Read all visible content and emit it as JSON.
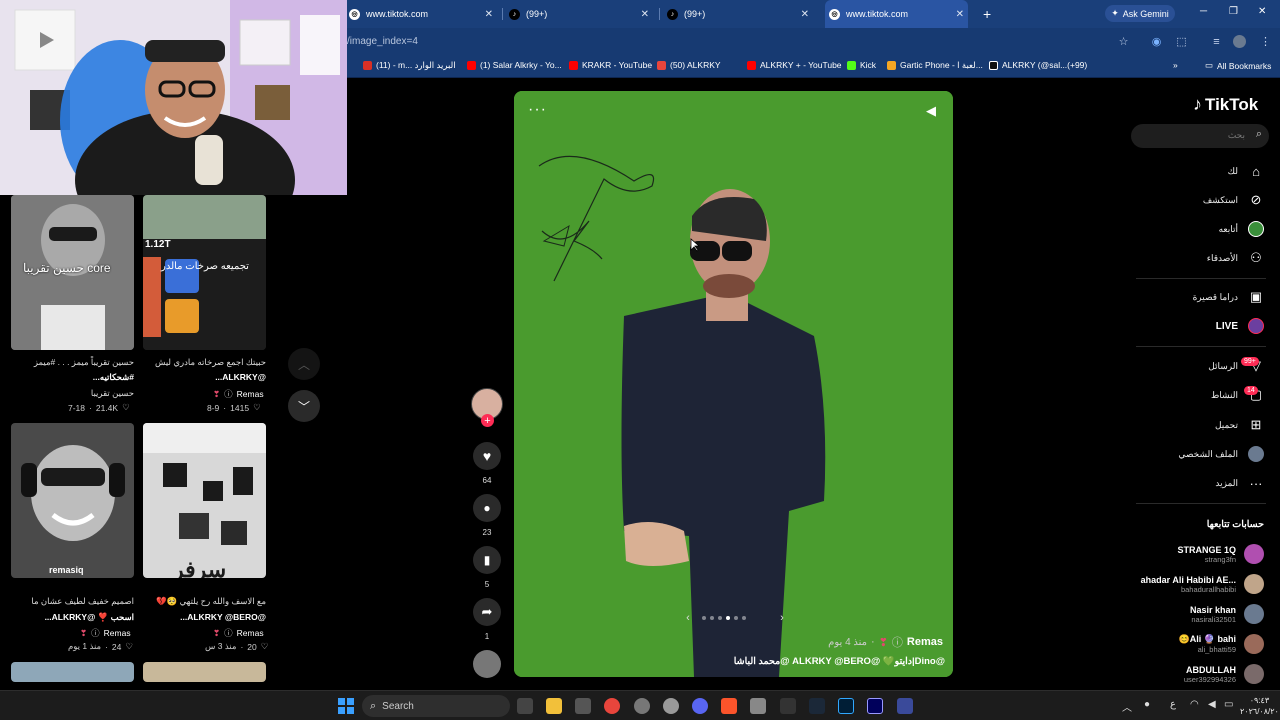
{
  "browser": {
    "tabs": [
      {
        "label": "www.tiktok.com"
      },
      {
        "label": "(99+)"
      },
      {
        "label": "(99+)"
      },
      {
        "label": "www.tiktok.com"
      }
    ],
    "gemini_label": "Ask Gemini",
    "url": "/image_index=4",
    "bookmarks": [
      {
        "label": "(11) - m... البريد الوارد",
        "color": "#d93025"
      },
      {
        "label": "(1) Salar Alkrky - Yo...",
        "color": "#ff0000"
      },
      {
        "label": "KRAKR - YouTube",
        "color": "#ff0000"
      },
      {
        "label": "(50) ALKRKY",
        "color": "#e8453c"
      },
      {
        "label": "ALKRKY + - YouTube",
        "color": "#ff0000"
      },
      {
        "label": "Kick",
        "color": "#53fc18"
      },
      {
        "label": "Gartic Phone - لعبة ا...",
        "color": "#f5a623"
      },
      {
        "label": "ALKRKY (@sal...(+99)",
        "color": "#111111"
      }
    ],
    "all_bookmarks": "All Bookmarks"
  },
  "grid": {
    "cards": [
      {
        "overlay": "حسين تقريبا core",
        "caption1": "حسين تقريباً ميمز . . . #ميمز",
        "caption2": "#شحكاتيه...",
        "author": "حسين تقريبا",
        "meta_date": "7-18",
        "meta_likes": "21.4K"
      },
      {
        "overlay": "1.12T",
        "overlay2": "تجميعه صرخات مالدر",
        "caption1": "حبيتك اجمع صرخاته مادري ليش",
        "caption2": "@ALKRKY...",
        "author": "Remas",
        "meta_date": "8-9",
        "meta_likes": "1415"
      },
      {
        "overlay": "remasiq",
        "caption1": "اصميم خفيف لطيف عشان ما",
        "caption2": "اسحب ❣️ @ALKRKY...",
        "author": "Remas",
        "meta_date": "منذ 1 يوم",
        "meta_likes": "24"
      },
      {
        "overlay": "سرفر",
        "caption1": "مع الاسف والله رح يلتهي 🥺💔",
        "caption2": "@ALKRKY @BERO...",
        "author": "Remas",
        "meta_date": "منذ 3 س",
        "meta_likes": "20"
      }
    ]
  },
  "post": {
    "author": "Remas",
    "time": "منذ 4 يوم",
    "caption": "@Dino|دايتو💚 @ALKRKY @BERO @محمد الباشا",
    "likes": "64",
    "comments": "23",
    "saves": "5",
    "shares": "1",
    "slides_total": 6,
    "slide_index": 3
  },
  "tiktok": {
    "logo": "TikTok",
    "search_placeholder": "بحث",
    "nav": [
      {
        "label": "لك",
        "icon": "home-icon"
      },
      {
        "label": "استكشف",
        "icon": "compass-icon"
      },
      {
        "label": "أتابعه",
        "icon": "following-avatar-icon"
      },
      {
        "label": "الأصدقاء",
        "icon": "friends-icon"
      },
      {
        "label": "دراما قصيرة",
        "icon": "drama-icon"
      },
      {
        "label": "LIVE",
        "icon": "live-icon"
      },
      {
        "label": "الرسائل",
        "icon": "messages-icon",
        "badge": "99+"
      },
      {
        "label": "النشاط",
        "icon": "activity-icon",
        "badge": "14"
      },
      {
        "label": "تحميل",
        "icon": "upload-icon"
      },
      {
        "label": "الملف الشخصي",
        "icon": "profile-icon"
      },
      {
        "label": "المزيد",
        "icon": "more-icon"
      }
    ],
    "following_title": "حسابات تتابعها",
    "following": [
      {
        "name": "STRANGE 1Q",
        "handle": "strang3fn",
        "color": "#b04fb0"
      },
      {
        "name": "ahadar Ali Habibi AE...",
        "handle": "bahadurallhabibi",
        "color": "#c0a58a"
      },
      {
        "name": "Nasir khan",
        "handle": "nasirali32501",
        "color": "#6a7a90"
      },
      {
        "name": "😊Ali 🔮 bahi",
        "handle": "ali_bhatti59",
        "color": "#9a6a5a"
      },
      {
        "name": "ABDULLAH",
        "handle": "user392994326",
        "color": "#7a6a6a"
      }
    ]
  },
  "taskbar": {
    "search": "Search",
    "lang": "ع",
    "time": "٠٩:٤٣",
    "date": "٢٠٢٦/٠٨/٢٠"
  }
}
